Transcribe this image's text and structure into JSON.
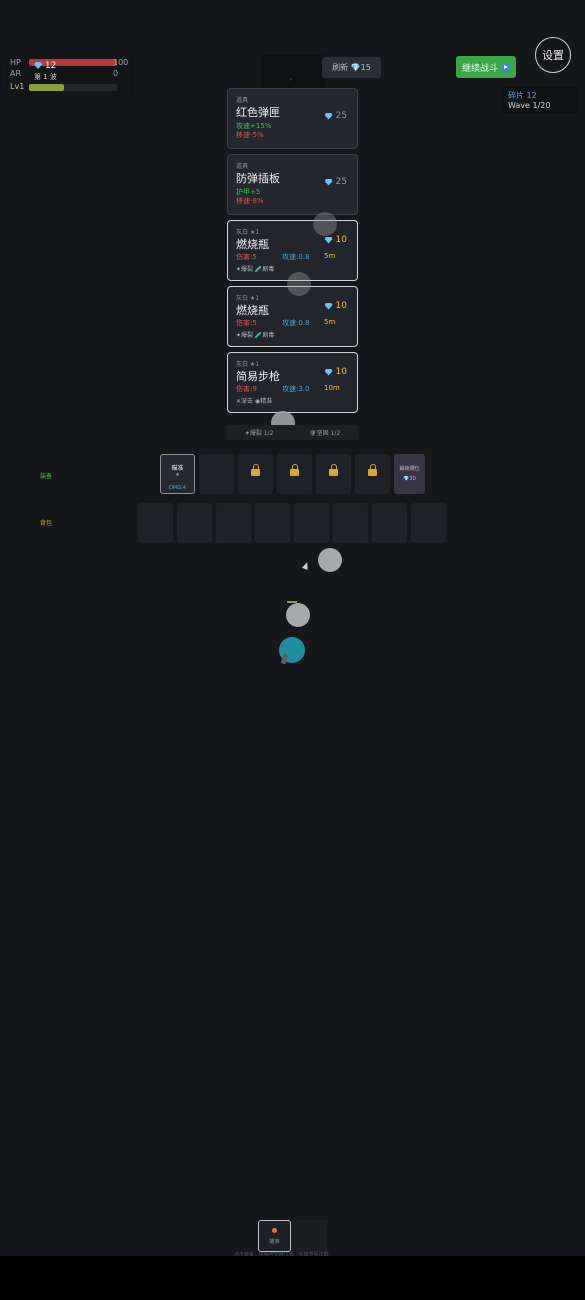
{
  "stats": {
    "hp_label": "HP",
    "hp_value": "100",
    "hp_fill": 1.0,
    "ar_label": "AR",
    "ar_value": "0",
    "lv_label": "Lv1",
    "xp_fill": 0.4,
    "gems": "12",
    "wave_text": "第 1 波"
  },
  "header": {
    "refresh_label": "刷新 💎15",
    "continue_label": "继续战斗",
    "settings_label": "设置",
    "shards_label": "碎片 12",
    "wave_label": "Wave 1/20"
  },
  "shop": [
    {
      "category": "道具",
      "name": "红色弹匣",
      "price": "25",
      "stats": [
        {
          "text": "攻速+15%",
          "color": "green"
        },
        {
          "text": "移速-5%",
          "color": "red"
        }
      ]
    },
    {
      "category": "道具",
      "name": "防弹插板",
      "price": "25",
      "stats": [
        {
          "text": "护甲+5",
          "color": "green"
        },
        {
          "text": "移速-8%",
          "color": "red"
        }
      ]
    },
    {
      "category": "灰白 ★1",
      "name": "燃烧瓶",
      "price": "10",
      "damage": "伤害:5",
      "speed": "攻速:0.8",
      "range": "5m",
      "tags": "✦爆裂 🧪剧毒"
    },
    {
      "category": "灰白 ★1",
      "name": "燃烧瓶",
      "price": "10",
      "damage": "伤害:5",
      "speed": "攻速:0.8",
      "range": "5m",
      "tags": "✦爆裂 🧪剧毒"
    },
    {
      "category": "灰白 ★1",
      "name": "简易步枪",
      "price": "10",
      "damage": "伤害:9",
      "speed": "攻速:3.0",
      "range": "10m",
      "tags": "✕深击 ◉精准"
    }
  ],
  "synergy": {
    "left": "✦爆裂 1/2",
    "right": "🛡坚固 1/2"
  },
  "equip_row": {
    "label": "装备",
    "slot1_name": "瞄准",
    "slot1_sub": "★",
    "slot1_detail": "DMG:4",
    "merge_label": "解锁槽位",
    "merge_price": "💎30"
  },
  "bag_row": {
    "label": "背包"
  },
  "bottom": {
    "slot_name": "瞄准",
    "footer": "点击装备 · 拖拽可交换位置 · 长按查看详细"
  }
}
